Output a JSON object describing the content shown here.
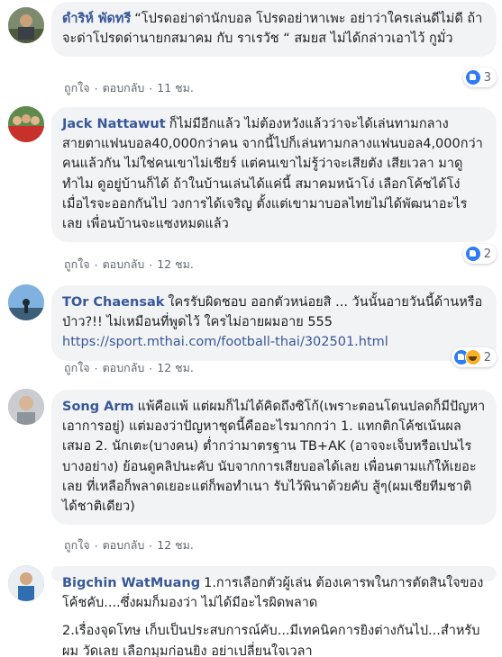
{
  "comments": [
    {
      "author": "ดำริห์ พัดทรี",
      "paragraphs": [
        "“โปรดอย่าด่านักบอล โปรดอย่าหาเพะ อย่าว่าใครเล่นดีไม่ดี ถ้าจะด่าโปรดด่านายกสมาคม กับ ราเรวัช “ สมยส ไม่ได้กล่าวเอาไว้ กูมั่ว"
      ],
      "reaction_count": "3",
      "like_label": "ถูกใจ",
      "reply_label": "ตอบกลับ",
      "time": "11 ชม."
    },
    {
      "author": "Jack Nattawut",
      "paragraphs": [
        "ก็ไม่มีอีกแล้ว ไม่ต้องหวังแล้วว่าจะได้เล่นทามกลางสายตาแฟนบอล40,000กว่าคน จากนี้ไปก็เล่นทามกลางแฟนบอล4,000กว่าคนแล้วกัน ไม่ใช่คนเขาไม่เชียร์ แต่คนเขาไม่รู้ว่าจะเสียตัง เสียเวลา มาดูทำไม ดูอยู่บ้านก็ได้ ถ้าในบ้านเล่นได้แค่นี้ สมาคมหน้าโง่ เลือกโค้ชได้โง่ เมื่อไรจะออกกันไป วงการได้เจริญ ตั้งแต่เขามาบอลไทยไม่ได้พัฒนาอะไรเลย เพื่อนบ้านจะแซงหมดแล้ว"
      ],
      "reaction_count": "2",
      "like_label": "ถูกใจ",
      "reply_label": "ตอบกลับ",
      "time": "12 ชม."
    },
    {
      "author": "TOr Chaensak",
      "paragraphs": [
        "ใครรับผิดชอบ ออกตัวหน่อยสิ ... วันนั้นอายวันนี้ด้านหรือป่าว?!! ไม่เหมือนที่พูดไว้ ใครไม่อายผมอาย 555"
      ],
      "link": "https://sport.mthai.com/football-thai/302501.html",
      "reaction_count": "2",
      "like_label": "ถูกใจ",
      "reply_label": "ตอบกลับ",
      "time": "12 ชม."
    },
    {
      "author": "Song Arm",
      "paragraphs": [
        "แพ้คือแพ้ แต่ผมก็ไม่ได้คิดถึงซิโก้(เพราะตอนโดนปลดก็มีปัญหาเอาการอยู่) แต่มองว่าปัญหาชุดนี้คืออะไรมากกว่า 1. แทกติกโค้ชเน้นผลเสมอ 2. นักเตะ(บางคน) ต่ำกว่ามาตรฐาน TB+AK (อาจจะเจ็บหรือเปนไรบางอย่าง) ย้อนดูคลิปนะคับ นับจากการเสียบอลได้เลย เพื่อนตามแก้ให้เยอะเลย ที่เหลือก็พลาดเยอะแต่ก็พอทำเนา รับไว้พินาด้วยคับ สู้ๆ(ผมเชียทีมชาติได้ชาติเดียว)"
      ],
      "like_label": "ถูกใจ",
      "reply_label": "ตอบกลับ",
      "time": "12 ชม."
    },
    {
      "author": "Bigchin WatMuang",
      "paragraphs": [
        "1.การเลือกตัวผู้เล่น ต้องเคารพในการตัดสินใจของโค้ชคับ....ซึ่งผมก็มองว่า ไม่ได้มีอะไรผิดพลาด",
        "2.เรื่องจุดโทษ เก็บเป็นประสบการณ์คับ...มีเทคนิคการยิงต่างกันไป...สำหรับผม วัดเลย เลือกมุมก่อนยิง อย่าเปลี่ยนใจเวลา"
      ]
    }
  ],
  "icons": {
    "like": "like-reaction-icon",
    "haha": "haha-reaction-icon"
  },
  "colors": {
    "author": "#385898",
    "bubble": "#f2f3f5",
    "meta": "#606770",
    "like_blue": "#2d7cf4"
  }
}
